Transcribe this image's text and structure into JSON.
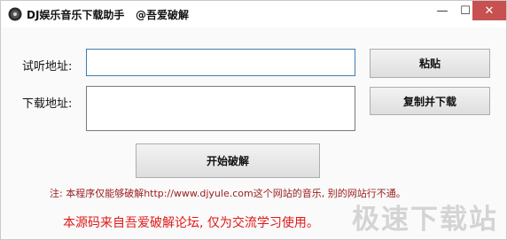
{
  "window": {
    "title": "DJ娱乐音乐下载助手   @吾爱破解",
    "minimize_label": "—",
    "maximize_label": "☐",
    "close_label": "✕"
  },
  "form": {
    "listen_label": "试听地址:",
    "listen_value": "",
    "download_label": "下载地址:",
    "download_value": ""
  },
  "buttons": {
    "paste": "粘贴",
    "copy_download": "复制并下载",
    "start_crack": "开始破解"
  },
  "notice": "注: 本程序仅能够破解http://www.djyule.com这个网站的音乐, 别的网站行不通。",
  "source_note": "本源码来自吾爱破解论坛, 仅为交流学习使用。",
  "watermark": "极速下载站",
  "colors": {
    "notice_text": "#9b1b1b",
    "source_text": "#e01818",
    "close_button": "#c75050",
    "input_focus_border": "#3c7fb1"
  },
  "icons": {
    "app": "disc-icon"
  }
}
